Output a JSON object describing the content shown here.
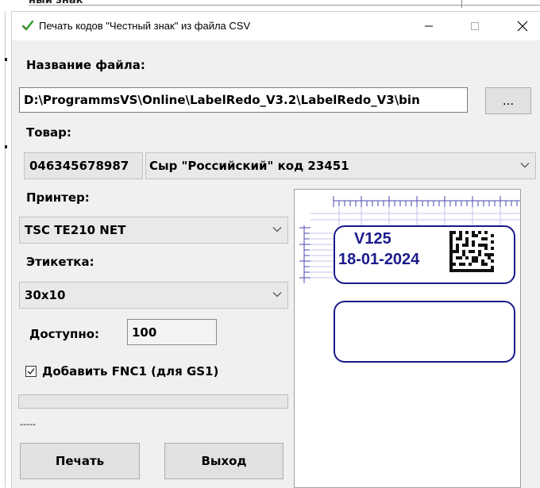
{
  "background": {
    "partial_text": "ный знак"
  },
  "window": {
    "title": "Печать кодов \"Честный знак\" из файла CSV",
    "controls": [
      "minimize",
      "maximize",
      "close"
    ]
  },
  "file": {
    "label": "Название файла:",
    "path": "D:\\ProgrammsVS\\Online\\LabelRedo_V3.2\\LabelRedo_V3\\bin",
    "browse_label": "..."
  },
  "product": {
    "label": "Товар:",
    "code": "046345678987",
    "name": "Сыр \"Российский\" код 23451"
  },
  "printer": {
    "label": "Принтер:",
    "selected": "TSC TE210 NET"
  },
  "label_type": {
    "label": "Этикетка:",
    "selected": "30x10"
  },
  "available": {
    "label": "Доступно:",
    "value": "100"
  },
  "fnc1": {
    "label": "Добавить FNC1 (для GS1)",
    "checked": true
  },
  "progress": {
    "value": 0
  },
  "status": {
    "text": "-----"
  },
  "buttons": {
    "print": "Печать",
    "exit": "Выход"
  },
  "preview": {
    "label_line1": "V125",
    "label_line2": "18-01-2024"
  },
  "colors": {
    "window_bg": "#f0f0f0",
    "label_ink": "#1a1a8c",
    "ruler": "#4a4ab0"
  },
  "icons": [
    "checkmark-app-icon",
    "minimize-icon",
    "maximize-icon",
    "close-icon",
    "chevron-down-icon",
    "checkbox-checked-icon",
    "datamatrix-code"
  ]
}
